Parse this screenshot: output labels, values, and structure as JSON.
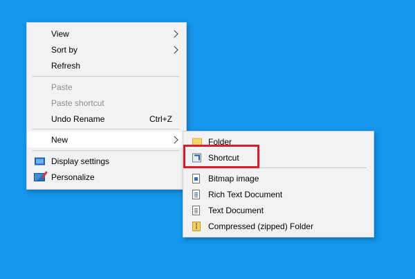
{
  "main_menu": {
    "view": "View",
    "sort_by": "Sort by",
    "refresh": "Refresh",
    "paste": "Paste",
    "paste_shortcut": "Paste shortcut",
    "undo_rename": "Undo Rename",
    "undo_shortcut": "Ctrl+Z",
    "new": "New",
    "display_settings": "Display settings",
    "personalize": "Personalize"
  },
  "new_submenu": {
    "folder": "Folder",
    "shortcut": "Shortcut",
    "bitmap_image": "Bitmap image",
    "rich_text_document": "Rich Text Document",
    "text_document": "Text Document",
    "compressed_folder": "Compressed (zipped) Folder"
  },
  "colors": {
    "desktop_background": "#1496ec",
    "menu_background": "#f2f2f2",
    "annotation_box": "#e11c2a"
  }
}
